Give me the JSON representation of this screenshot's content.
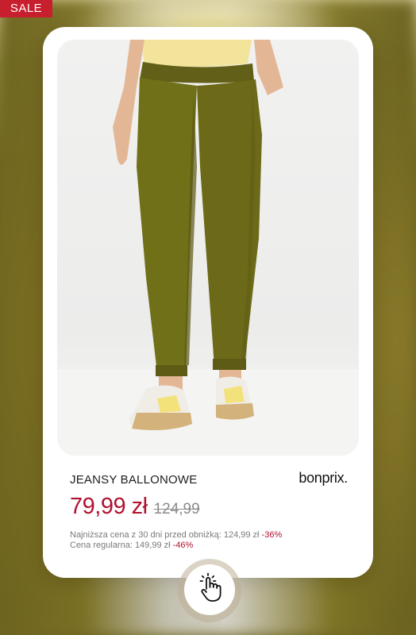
{
  "badge": {
    "label": "SALE"
  },
  "product": {
    "title": "JEANSY BALLONOWE",
    "brand": "bonprix.",
    "price_current": "79,99 zł",
    "price_old": "124,99",
    "lowest_price_label": "Najniższa cena z 30 dni przed obniżką: 124,99 zł",
    "lowest_price_discount": "-36%",
    "regular_price_label": "Cena regularna: 149,99 zł",
    "regular_price_discount": "-46%"
  },
  "colors": {
    "sale_red": "#c71f2e",
    "price_red": "#b1122f",
    "pants_olive": "#6e6a1c"
  },
  "icons": {
    "cta": "tap-hand-icon"
  }
}
